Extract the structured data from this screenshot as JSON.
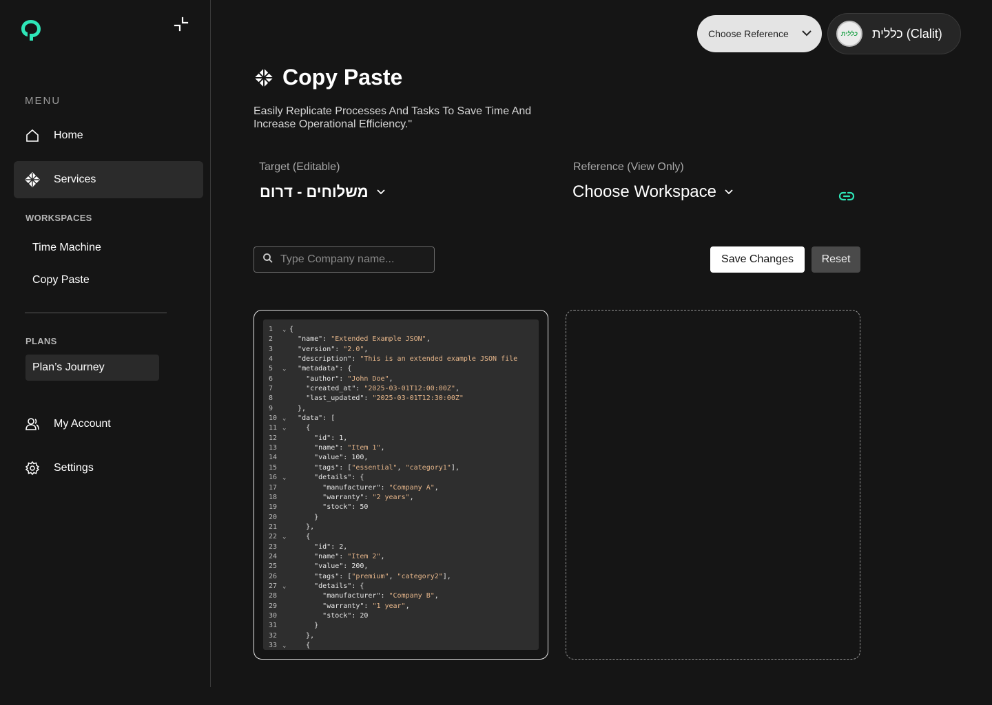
{
  "sidebar": {
    "menu_label": "MENU",
    "nav": [
      {
        "label": "Home",
        "icon": "home-icon"
      },
      {
        "label": "Services",
        "icon": "services-icon",
        "active": true
      }
    ],
    "workspaces_label": "WORKSPACES",
    "workspaces": [
      "Time Machine",
      "Copy Paste"
    ],
    "plans_label": "PLANS",
    "plan_item": "Plan’s Journey",
    "bottom_nav": [
      {
        "label": "My Account",
        "icon": "user-icon"
      },
      {
        "label": "Settings",
        "icon": "gear-icon"
      }
    ]
  },
  "topbar": {
    "reference_dropdown": "Choose Reference",
    "org_name": "כללית (Clalit)",
    "org_avatar_text": "כללית"
  },
  "page": {
    "title": "Copy Paste",
    "subtitle": "Easily Replicate Processes And Tasks To Save Time And Increase Operational Efficiency.\"",
    "target_label": "Target (Editable)",
    "target_value": "משלוחים - דרום",
    "reference_label": "Reference (View Only)",
    "reference_value": "Choose Workspace",
    "search_placeholder": "Type Company name...",
    "save_label": "Save Changes",
    "reset_label": "Reset"
  },
  "editor": {
    "lines": [
      {
        "n": "1",
        "fold": true,
        "t": "{"
      },
      {
        "n": "2",
        "t": "  \"name\": \"Extended Example JSON\","
      },
      {
        "n": "3",
        "t": "  \"version\": \"2.0\","
      },
      {
        "n": "4",
        "t": "  \"description\": \"This is an extended example JSON file"
      },
      {
        "n": "5",
        "fold": true,
        "t": "  \"metadata\": {"
      },
      {
        "n": "6",
        "t": "    \"author\": \"John Doe\","
      },
      {
        "n": "7",
        "t": "    \"created_at\": \"2025-03-01T12:00:00Z\","
      },
      {
        "n": "8",
        "t": "    \"last_updated\": \"2025-03-01T12:30:00Z\""
      },
      {
        "n": "9",
        "t": "  },"
      },
      {
        "n": "10",
        "fold": true,
        "t": "  \"data\": ["
      },
      {
        "n": "11",
        "fold": true,
        "t": "    {"
      },
      {
        "n": "12",
        "t": "      \"id\": 1,"
      },
      {
        "n": "13",
        "t": "      \"name\": \"Item 1\","
      },
      {
        "n": "14",
        "t": "      \"value\": 100,"
      },
      {
        "n": "15",
        "t": "      \"tags\": [\"essential\", \"category1\"],"
      },
      {
        "n": "16",
        "fold": true,
        "t": "      \"details\": {"
      },
      {
        "n": "17",
        "t": "        \"manufacturer\": \"Company A\","
      },
      {
        "n": "18",
        "t": "        \"warranty\": \"2 years\","
      },
      {
        "n": "19",
        "t": "        \"stock\": 50"
      },
      {
        "n": "20",
        "t": "      }"
      },
      {
        "n": "21",
        "t": "    },"
      },
      {
        "n": "22",
        "fold": true,
        "t": "    {"
      },
      {
        "n": "23",
        "t": "      \"id\": 2,"
      },
      {
        "n": "24",
        "t": "      \"name\": \"Item 2\","
      },
      {
        "n": "25",
        "t": "      \"value\": 200,"
      },
      {
        "n": "26",
        "t": "      \"tags\": [\"premium\", \"category2\"],"
      },
      {
        "n": "27",
        "fold": true,
        "t": "      \"details\": {"
      },
      {
        "n": "28",
        "t": "        \"manufacturer\": \"Company B\","
      },
      {
        "n": "29",
        "t": "        \"warranty\": \"1 year\","
      },
      {
        "n": "30",
        "t": "        \"stock\": 20"
      },
      {
        "n": "31",
        "t": "      }"
      },
      {
        "n": "32",
        "t": "    },"
      },
      {
        "n": "33",
        "fold": true,
        "t": "    {"
      }
    ]
  },
  "colors": {
    "accent": "#2ee6b8",
    "background": "#151515",
    "string": "#e6b68a"
  }
}
